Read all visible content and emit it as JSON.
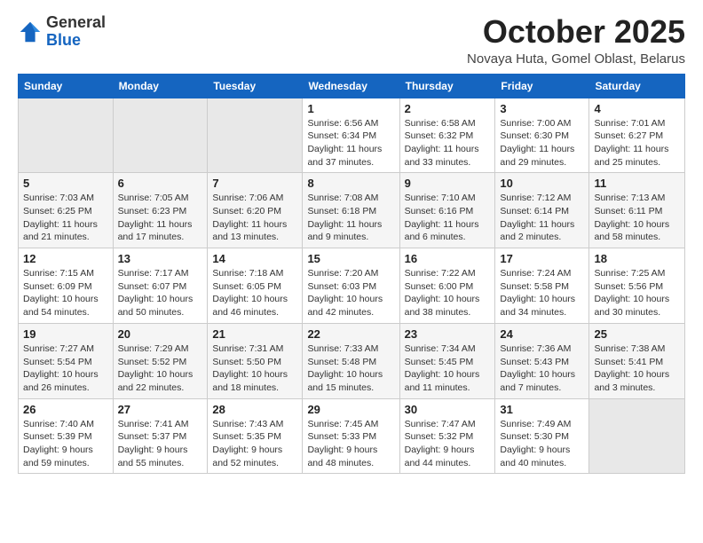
{
  "header": {
    "logo_line1": "General",
    "logo_line2": "Blue",
    "month_title": "October 2025",
    "subtitle": "Novaya Huta, Gomel Oblast, Belarus"
  },
  "weekdays": [
    "Sunday",
    "Monday",
    "Tuesday",
    "Wednesday",
    "Thursday",
    "Friday",
    "Saturday"
  ],
  "weeks": [
    [
      {
        "day": "",
        "sunrise": "",
        "sunset": "",
        "daylight": ""
      },
      {
        "day": "",
        "sunrise": "",
        "sunset": "",
        "daylight": ""
      },
      {
        "day": "",
        "sunrise": "",
        "sunset": "",
        "daylight": ""
      },
      {
        "day": "1",
        "sunrise": "Sunrise: 6:56 AM",
        "sunset": "Sunset: 6:34 PM",
        "daylight": "Daylight: 11 hours and 37 minutes."
      },
      {
        "day": "2",
        "sunrise": "Sunrise: 6:58 AM",
        "sunset": "Sunset: 6:32 PM",
        "daylight": "Daylight: 11 hours and 33 minutes."
      },
      {
        "day": "3",
        "sunrise": "Sunrise: 7:00 AM",
        "sunset": "Sunset: 6:30 PM",
        "daylight": "Daylight: 11 hours and 29 minutes."
      },
      {
        "day": "4",
        "sunrise": "Sunrise: 7:01 AM",
        "sunset": "Sunset: 6:27 PM",
        "daylight": "Daylight: 11 hours and 25 minutes."
      }
    ],
    [
      {
        "day": "5",
        "sunrise": "Sunrise: 7:03 AM",
        "sunset": "Sunset: 6:25 PM",
        "daylight": "Daylight: 11 hours and 21 minutes."
      },
      {
        "day": "6",
        "sunrise": "Sunrise: 7:05 AM",
        "sunset": "Sunset: 6:23 PM",
        "daylight": "Daylight: 11 hours and 17 minutes."
      },
      {
        "day": "7",
        "sunrise": "Sunrise: 7:06 AM",
        "sunset": "Sunset: 6:20 PM",
        "daylight": "Daylight: 11 hours and 13 minutes."
      },
      {
        "day": "8",
        "sunrise": "Sunrise: 7:08 AM",
        "sunset": "Sunset: 6:18 PM",
        "daylight": "Daylight: 11 hours and 9 minutes."
      },
      {
        "day": "9",
        "sunrise": "Sunrise: 7:10 AM",
        "sunset": "Sunset: 6:16 PM",
        "daylight": "Daylight: 11 hours and 6 minutes."
      },
      {
        "day": "10",
        "sunrise": "Sunrise: 7:12 AM",
        "sunset": "Sunset: 6:14 PM",
        "daylight": "Daylight: 11 hours and 2 minutes."
      },
      {
        "day": "11",
        "sunrise": "Sunrise: 7:13 AM",
        "sunset": "Sunset: 6:11 PM",
        "daylight": "Daylight: 10 hours and 58 minutes."
      }
    ],
    [
      {
        "day": "12",
        "sunrise": "Sunrise: 7:15 AM",
        "sunset": "Sunset: 6:09 PM",
        "daylight": "Daylight: 10 hours and 54 minutes."
      },
      {
        "day": "13",
        "sunrise": "Sunrise: 7:17 AM",
        "sunset": "Sunset: 6:07 PM",
        "daylight": "Daylight: 10 hours and 50 minutes."
      },
      {
        "day": "14",
        "sunrise": "Sunrise: 7:18 AM",
        "sunset": "Sunset: 6:05 PM",
        "daylight": "Daylight: 10 hours and 46 minutes."
      },
      {
        "day": "15",
        "sunrise": "Sunrise: 7:20 AM",
        "sunset": "Sunset: 6:03 PM",
        "daylight": "Daylight: 10 hours and 42 minutes."
      },
      {
        "day": "16",
        "sunrise": "Sunrise: 7:22 AM",
        "sunset": "Sunset: 6:00 PM",
        "daylight": "Daylight: 10 hours and 38 minutes."
      },
      {
        "day": "17",
        "sunrise": "Sunrise: 7:24 AM",
        "sunset": "Sunset: 5:58 PM",
        "daylight": "Daylight: 10 hours and 34 minutes."
      },
      {
        "day": "18",
        "sunrise": "Sunrise: 7:25 AM",
        "sunset": "Sunset: 5:56 PM",
        "daylight": "Daylight: 10 hours and 30 minutes."
      }
    ],
    [
      {
        "day": "19",
        "sunrise": "Sunrise: 7:27 AM",
        "sunset": "Sunset: 5:54 PM",
        "daylight": "Daylight: 10 hours and 26 minutes."
      },
      {
        "day": "20",
        "sunrise": "Sunrise: 7:29 AM",
        "sunset": "Sunset: 5:52 PM",
        "daylight": "Daylight: 10 hours and 22 minutes."
      },
      {
        "day": "21",
        "sunrise": "Sunrise: 7:31 AM",
        "sunset": "Sunset: 5:50 PM",
        "daylight": "Daylight: 10 hours and 18 minutes."
      },
      {
        "day": "22",
        "sunrise": "Sunrise: 7:33 AM",
        "sunset": "Sunset: 5:48 PM",
        "daylight": "Daylight: 10 hours and 15 minutes."
      },
      {
        "day": "23",
        "sunrise": "Sunrise: 7:34 AM",
        "sunset": "Sunset: 5:45 PM",
        "daylight": "Daylight: 10 hours and 11 minutes."
      },
      {
        "day": "24",
        "sunrise": "Sunrise: 7:36 AM",
        "sunset": "Sunset: 5:43 PM",
        "daylight": "Daylight: 10 hours and 7 minutes."
      },
      {
        "day": "25",
        "sunrise": "Sunrise: 7:38 AM",
        "sunset": "Sunset: 5:41 PM",
        "daylight": "Daylight: 10 hours and 3 minutes."
      }
    ],
    [
      {
        "day": "26",
        "sunrise": "Sunrise: 7:40 AM",
        "sunset": "Sunset: 5:39 PM",
        "daylight": "Daylight: 9 hours and 59 minutes."
      },
      {
        "day": "27",
        "sunrise": "Sunrise: 7:41 AM",
        "sunset": "Sunset: 5:37 PM",
        "daylight": "Daylight: 9 hours and 55 minutes."
      },
      {
        "day": "28",
        "sunrise": "Sunrise: 7:43 AM",
        "sunset": "Sunset: 5:35 PM",
        "daylight": "Daylight: 9 hours and 52 minutes."
      },
      {
        "day": "29",
        "sunrise": "Sunrise: 7:45 AM",
        "sunset": "Sunset: 5:33 PM",
        "daylight": "Daylight: 9 hours and 48 minutes."
      },
      {
        "day": "30",
        "sunrise": "Sunrise: 7:47 AM",
        "sunset": "Sunset: 5:32 PM",
        "daylight": "Daylight: 9 hours and 44 minutes."
      },
      {
        "day": "31",
        "sunrise": "Sunrise: 7:49 AM",
        "sunset": "Sunset: 5:30 PM",
        "daylight": "Daylight: 9 hours and 40 minutes."
      },
      {
        "day": "",
        "sunrise": "",
        "sunset": "",
        "daylight": ""
      }
    ]
  ]
}
